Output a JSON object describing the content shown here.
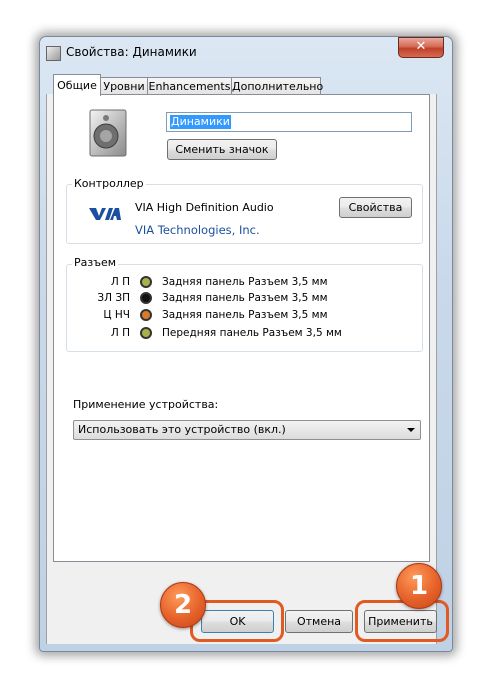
{
  "window": {
    "title": "Свойства: Динамики",
    "close_label": "✕"
  },
  "tabs": [
    {
      "label": "Общие"
    },
    {
      "label": "Уровни"
    },
    {
      "label": "Enhancements"
    },
    {
      "label": "Дополнительно"
    }
  ],
  "general": {
    "device_icon": "speaker-icon",
    "name_value": "Динамики",
    "change_icon_label": "Сменить значок"
  },
  "controller": {
    "group_label": "Контроллер",
    "logo": "via-logo",
    "name": "VIA High Definition Audio",
    "vendor_link": "VIA Technologies, Inc.",
    "properties_label": "Свойства"
  },
  "jacks": {
    "group_label": "Разъем",
    "rows": [
      {
        "code": "Л П",
        "color": "#a9b24a",
        "text": "Задняя панель Разъем 3,5 мм"
      },
      {
        "code": "ЗЛ ЗП",
        "color": "#111111",
        "text": "Задняя панель Разъем 3,5 мм"
      },
      {
        "code": "Ц НЧ",
        "color": "#d97a2b",
        "text": "Задняя панель Разъем 3,5 мм"
      },
      {
        "code": "Л П",
        "color": "#a9b24a",
        "text": "Передняя панель Разъем 3,5 мм"
      }
    ]
  },
  "usage": {
    "label": "Применение устройства:",
    "selected": "Использовать это устройство (вкл.)"
  },
  "buttons": {
    "ok": "OK",
    "cancel": "Отмена",
    "apply": "Применить"
  },
  "annotations": {
    "badge_1": "1",
    "badge_2": "2",
    "accent": "#e15a24"
  }
}
